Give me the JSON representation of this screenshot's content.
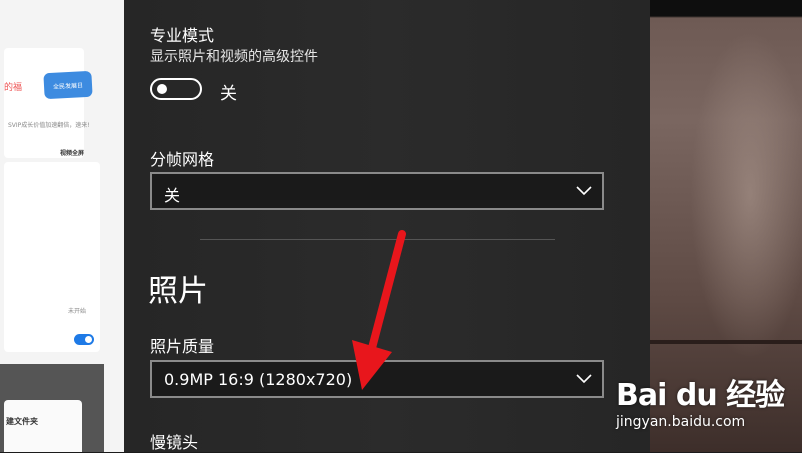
{
  "settings": {
    "pro_mode": {
      "title": "专业模式",
      "description": "显示照片和视频的高级控件",
      "toggle_state": "关"
    },
    "framing_grid": {
      "title": "分帧网格",
      "selected": "关"
    },
    "photo_section": {
      "heading": "照片",
      "quality_title": "照片质量",
      "quality_selected": "0.9MP 16:9 (1280x720)",
      "next_title": "慢镜头"
    }
  },
  "background_app": {
    "badge": "全民发展日",
    "texts": [
      "的福",
      "SVIP成长价值加速翻倍，速来!",
      "视频全屏",
      "未开始",
      "建文件夹"
    ]
  },
  "watermark": {
    "logo": "Bai du 经验",
    "url": "jingyan.baidu.com"
  },
  "colors": {
    "panel_bg": "#2a2a2a",
    "annotation_arrow": "#e8161c",
    "toggle_accent": "#1e7ae6"
  },
  "icons": [
    "chevron-down-icon",
    "toggle-switch",
    "annotation-arrow",
    "baidu-paw-icon"
  ]
}
